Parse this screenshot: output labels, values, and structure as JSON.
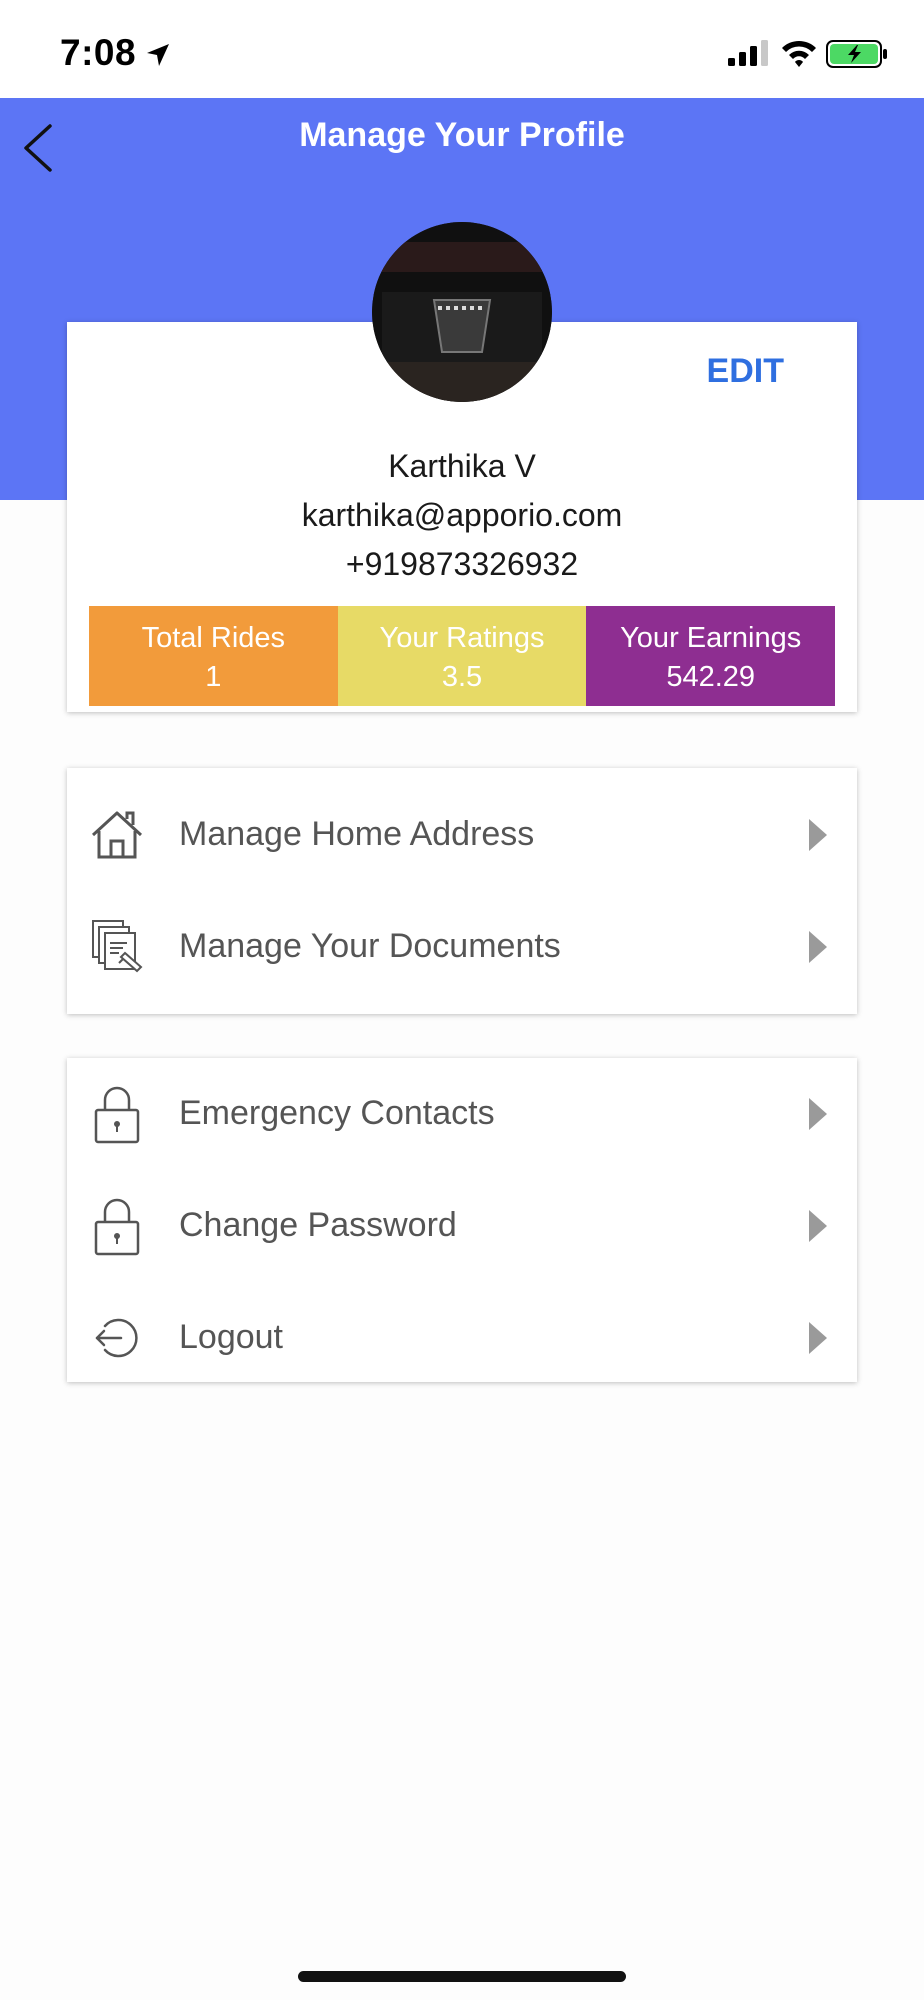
{
  "status_bar": {
    "time": "7:08"
  },
  "header": {
    "title": "Manage Your Profile",
    "background_color": "#5c75f5"
  },
  "profile": {
    "edit_label": "EDIT",
    "name": "Karthika V",
    "email": "karthika@apporio.com",
    "phone": "+919873326932",
    "stats": [
      {
        "label": "Total Rides",
        "value": "1",
        "color": "#f29b3b"
      },
      {
        "label": "Your Ratings",
        "value": "3.5",
        "color": "#e7da66"
      },
      {
        "label": "Your Earnings",
        "value": "542.29",
        "color": "#8e2e91"
      }
    ]
  },
  "menu_group_1": [
    {
      "label": "Manage Home Address",
      "icon": "home-icon"
    },
    {
      "label": "Manage Your Documents",
      "icon": "documents-icon"
    }
  ],
  "menu_group_2": [
    {
      "label": "Emergency Contacts",
      "icon": "lock-icon"
    },
    {
      "label": "Change Password",
      "icon": "lock-icon"
    },
    {
      "label": "Logout",
      "icon": "logout-icon"
    }
  ],
  "accent_color": "#2f6fe0"
}
